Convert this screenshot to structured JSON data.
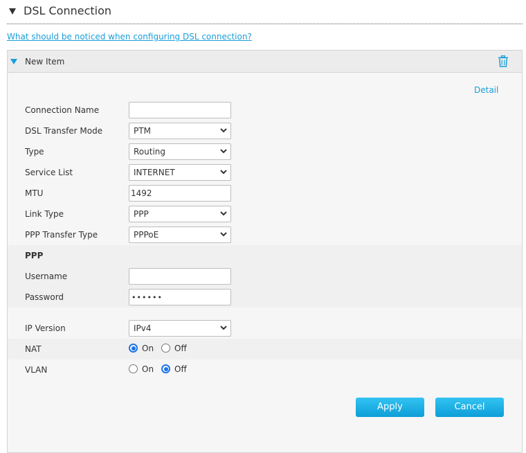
{
  "section": {
    "title": "DSL Connection",
    "collapse_icon": "triangle-down-icon"
  },
  "help_link": "What should be noticed when configuring DSL connection?",
  "panel": {
    "title": "New Item",
    "expand_icon": "triangle-down-icon",
    "delete_icon": "trash-icon",
    "detail_link": "Detail",
    "accent_color": "#1a9ed9"
  },
  "form": {
    "connection_name": {
      "label": "Connection Name",
      "value": ""
    },
    "dsl_transfer_mode": {
      "label": "DSL Transfer Mode",
      "value": "PTM"
    },
    "type": {
      "label": "Type",
      "value": "Routing"
    },
    "service_list": {
      "label": "Service List",
      "value": "INTERNET"
    },
    "mtu": {
      "label": "MTU",
      "value": "1492"
    },
    "link_type": {
      "label": "Link Type",
      "value": "PPP"
    },
    "ppp_transfer_type": {
      "label": "PPP Transfer Type",
      "value": "PPPoE"
    },
    "ppp_section": {
      "label": "PPP"
    },
    "username": {
      "label": "Username",
      "value": ""
    },
    "password": {
      "label": "Password",
      "value": "••••••"
    },
    "ip_version": {
      "label": "IP Version",
      "value": "IPv4"
    },
    "nat": {
      "label": "NAT",
      "on_label": "On",
      "off_label": "Off",
      "selected": "On"
    },
    "vlan": {
      "label": "VLAN",
      "on_label": "On",
      "off_label": "Off",
      "selected": "Off"
    }
  },
  "buttons": {
    "apply": "Apply",
    "cancel": "Cancel"
  }
}
